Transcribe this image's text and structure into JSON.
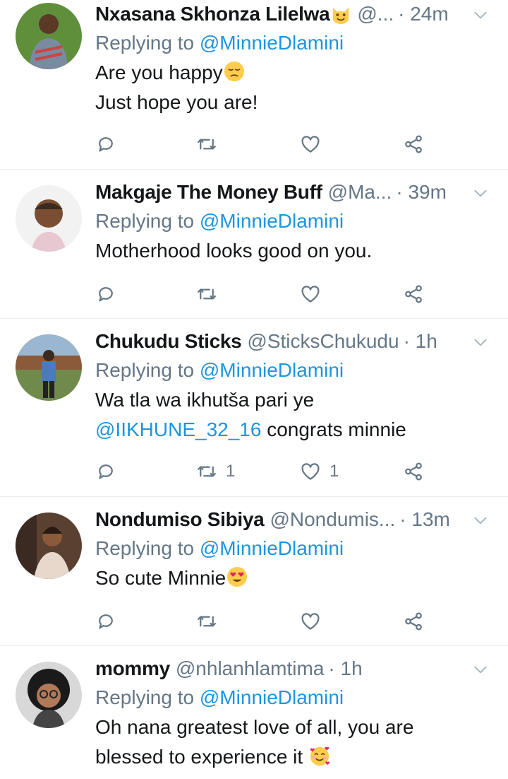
{
  "tweets": [
    {
      "name": "Nxasana Skhonza Lilelwa",
      "handle": "@...",
      "time": "· 24m",
      "replying_label": "Replying to",
      "replying_to": "@MinnieDlamini",
      "lines": [
        "Are you happy",
        "Just hope you are!"
      ],
      "name_emoji": "smiling-cat-emoji",
      "line_emoji": "pensive-face-emoji",
      "reply_count": "",
      "retweet_count": "",
      "like_count": ""
    },
    {
      "name": "Makgaje The Money Buff",
      "handle": "@Ma...",
      "time": "· 39m",
      "replying_label": "Replying to",
      "replying_to": "@MinnieDlamini",
      "lines": [
        "Motherhood looks good on you."
      ],
      "reply_count": "",
      "retweet_count": "",
      "like_count": ""
    },
    {
      "name": "Chukudu Sticks",
      "handle": "@SticksChukudu",
      "time": "· 1h",
      "replying_label": "Replying to",
      "replying_to": "@MinnieDlamini",
      "line1": "Wa tla wa ikhutša pari ye",
      "line2_mention": "@IIKHUNE_32_16",
      "line2_text": " congrats minnie",
      "reply_count": "",
      "retweet_count": "1",
      "like_count": "1"
    },
    {
      "name": "Nondumiso Sibiya",
      "handle": "@Nondumis...",
      "time": "· 13m",
      "replying_label": "Replying to",
      "replying_to": "@MinnieDlamini",
      "lines": [
        "So cute Minnie"
      ],
      "line_emoji": "heart-eyes-emoji",
      "reply_count": "",
      "retweet_count": "",
      "like_count": ""
    },
    {
      "name": "mommy",
      "handle": "@nhlanhlamtima",
      "time": "· 1h",
      "replying_label": "Replying to",
      "replying_to": "@MinnieDlamini",
      "lines": [
        "Oh nana greatest love of all,  you are",
        "blessed to experience it"
      ],
      "line_emoji": "smiling-face-with-hearts-emoji"
    }
  ],
  "colors": {
    "secondary": "#657786",
    "link": "#1b95e0",
    "divider": "#e6ecf0"
  }
}
